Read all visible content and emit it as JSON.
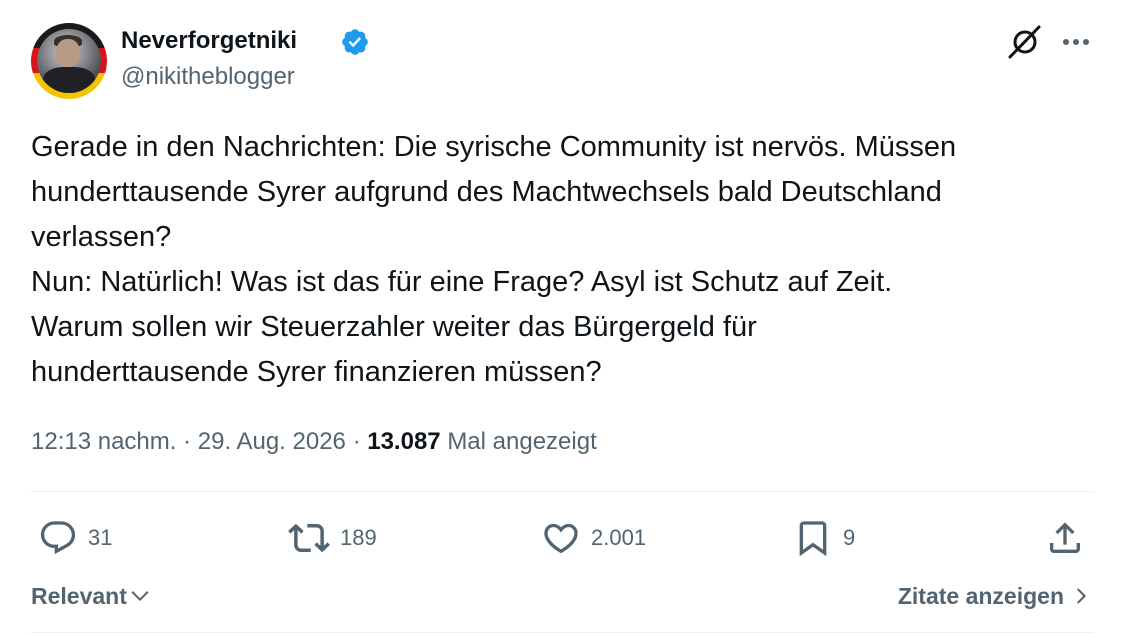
{
  "author": {
    "display_name": "Neverforgetniki",
    "handle": "@nikitheblogger",
    "verified": true
  },
  "post": {
    "lines": [
      "Gerade in den Nachrichten: Die syrische Community ist nervös. Müssen",
      "hunderttausende Syrer aufgrund des Machtwechsels bald Deutschland",
      "verlassen?",
      "Nun: Natürlich! Was ist das für eine Frage? Asyl ist Schutz auf Zeit.",
      "Warum sollen wir Steuerzahler weiter das Bürgergeld für",
      "hunderttausende Syrer finanzieren müssen?"
    ]
  },
  "meta": {
    "time": "12:13 nachm.",
    "separator": " · ",
    "date": "29. Aug. 2026",
    "views_count": "13.087",
    "views_label": "Mal angezeigt"
  },
  "actions": {
    "replies": "31",
    "reposts": "189",
    "likes": "2.001",
    "bookmarks": "9"
  },
  "footer": {
    "sort_label": "Relevant",
    "quotes_label": "Zitate anzeigen"
  },
  "colors": {
    "text": "#0f1419",
    "secondary": "#536471",
    "verified": "#1d9bf0",
    "divider": "#eff3f4"
  },
  "icons": [
    "verified-badge-icon",
    "grok-icon",
    "more-icon",
    "reply-icon",
    "repost-icon",
    "like-icon",
    "bookmark-icon",
    "share-icon",
    "chevron-down-icon",
    "chevron-right-icon"
  ]
}
